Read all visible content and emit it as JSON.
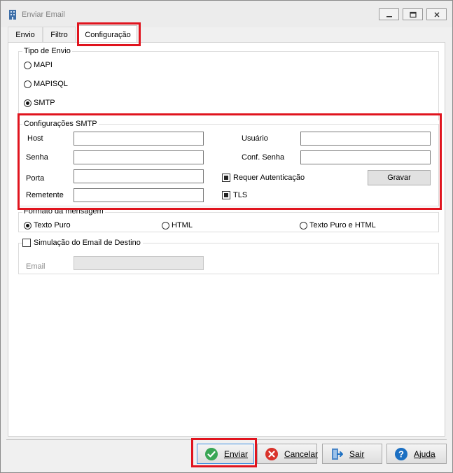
{
  "window": {
    "title": "Enviar Email"
  },
  "tabs": [
    {
      "label": "Envio"
    },
    {
      "label": "Filtro"
    },
    {
      "label": "Configuração"
    }
  ],
  "tipo_envio": {
    "title": "Tipo de Envio",
    "options": [
      {
        "label": "MAPI",
        "checked": false
      },
      {
        "label": "MAPISQL",
        "checked": false
      },
      {
        "label": "SMTP",
        "checked": true
      }
    ]
  },
  "smtp": {
    "title": "Configurações SMTP",
    "host_label": "Host",
    "host_value": "",
    "usuario_label": "Usuário",
    "usuario_value": "",
    "senha_label": "Senha",
    "senha_value": "",
    "conf_senha_label": "Conf. Senha",
    "conf_senha_value": "",
    "porta_label": "Porta",
    "porta_value": "",
    "remetente_label": "Remetente",
    "remetente_value": "",
    "requer_autenticacao_label": "Requer Autenticação",
    "requer_autenticacao_checked": true,
    "tls_label": "TLS",
    "tls_checked": true,
    "gravar_label": "Gravar"
  },
  "formato": {
    "title": "Formato da mensagem",
    "options": [
      {
        "label": "Texto Puro",
        "checked": true
      },
      {
        "label": "HTML",
        "checked": false
      },
      {
        "label": "Texto Puro e HTML",
        "checked": false
      }
    ]
  },
  "simulacao": {
    "title": "Simulação do Email de Destino",
    "checked": false,
    "email_label": "Email",
    "email_value": ""
  },
  "actions": {
    "enviar": {
      "label": "Enviar",
      "icon": "check-circle-icon"
    },
    "cancelar": {
      "label": "Cancelar",
      "icon": "x-circle-icon"
    },
    "sair": {
      "label": "Sair",
      "icon": "exit-door-icon"
    },
    "ajuda": {
      "label": "Ajuda",
      "icon": "help-circle-icon"
    }
  },
  "colors": {
    "highlight": "#e0141e",
    "accent_blue": "#1b6fc2",
    "success_green": "#3aa655",
    "danger_red": "#d9332b"
  }
}
